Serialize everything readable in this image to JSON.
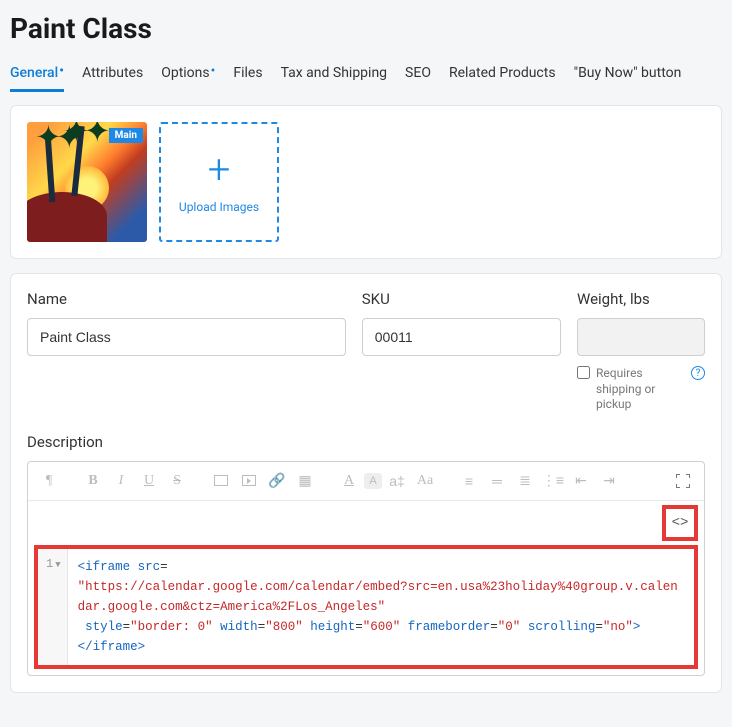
{
  "page_title": "Paint Class",
  "tabs": {
    "general": "General",
    "attributes": "Attributes",
    "options": "Options",
    "files": "Files",
    "tax": "Tax and Shipping",
    "seo": "SEO",
    "related": "Related Products",
    "buynow": "\"Buy Now\" button"
  },
  "images": {
    "main_badge": "Main",
    "upload_label": "Upload Images"
  },
  "fields": {
    "name_label": "Name",
    "name_value": "Paint Class",
    "sku_label": "SKU",
    "sku_value": "00011",
    "weight_label": "Weight, lbs",
    "weight_value": "",
    "requires_shipping_label": "Requires shipping or pickup"
  },
  "description": {
    "label": "Description",
    "gutter_line": "1",
    "code_parts": {
      "open_tag": "<iframe",
      "src_attr": " src",
      "eq": "=",
      "url": "\"https://calendar.google.com/calendar/embed?src=en.usa%23holiday%40group.v.calendar.google.com&ctz=America%2FLos_Angeles\"",
      "style_attr": " style",
      "style_val": "\"border: 0\"",
      "width_attr": " width",
      "width_val": "\"800\"",
      "height_attr": " height",
      "height_val": "\"600\"",
      "fb_attr": " frameborder",
      "fb_val": "\"0\"",
      "scroll_attr": " scrolling",
      "scroll_val": "\"no\"",
      "close": ">",
      "end_tag": "</iframe>"
    }
  }
}
